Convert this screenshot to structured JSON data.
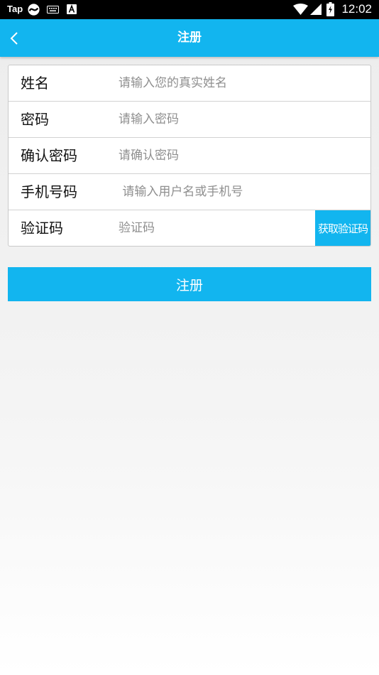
{
  "status_bar": {
    "left_text": "Tap",
    "time": "12:02",
    "icons": [
      "snake-icon",
      "keyboard-icon",
      "a-icon",
      "wifi-icon",
      "signal-icon",
      "battery-icon"
    ]
  },
  "app_bar": {
    "title": "注册",
    "back_icon": "chevron-left-icon",
    "color": "#12b5ef"
  },
  "form": {
    "rows": [
      {
        "label": "姓名",
        "placeholder": "请输入您的真实姓名",
        "value": ""
      },
      {
        "label": "密码",
        "placeholder": "请输入密码",
        "value": ""
      },
      {
        "label": "确认密码",
        "placeholder": "请确认密码",
        "value": ""
      },
      {
        "label": "手机号码",
        "placeholder": " 请输入用户名或手机号",
        "value": ""
      },
      {
        "label": "验证码",
        "placeholder": "验证码",
        "value": ""
      }
    ],
    "get_code_label": "获取验证码"
  },
  "submit_label": "注册"
}
